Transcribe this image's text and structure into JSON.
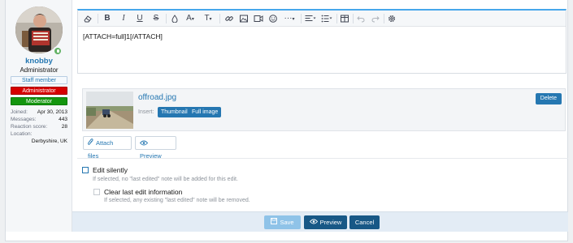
{
  "user": {
    "username": "knobby",
    "title": "Administrator",
    "banners": {
      "staff": "Staff member",
      "admin": "Administrator",
      "moderator": "Moderator"
    },
    "stats": [
      {
        "label": "Joined:",
        "value": "Apr 30, 2013"
      },
      {
        "label": "Messages:",
        "value": "443"
      },
      {
        "label": "Reaction score:",
        "value": "28"
      },
      {
        "label": "Location:",
        "value": ""
      }
    ],
    "location": "Derbyshire, UK"
  },
  "toolbar": {
    "icons": [
      "eraser-icon",
      "bold-icon",
      "italic-icon",
      "underline-icon",
      "strikethrough-icon",
      "text-color-icon",
      "font-family-icon",
      "font-size-icon",
      "link-icon",
      "image-icon",
      "media-icon",
      "smilies-icon",
      "more-options-icon",
      "align-icon",
      "list-icon",
      "table-icon",
      "undo-icon",
      "redo-icon",
      "settings-icon"
    ],
    "bold": "B",
    "italic": "I",
    "underline": "U",
    "strikethrough": "S",
    "font_family": "A",
    "font_size": "T",
    "more": "···"
  },
  "editor": {
    "content": "[ATTACH=full]1[/ATTACH]"
  },
  "attachment": {
    "file_name": "offroad.jpg",
    "insert_label": "Insert:",
    "thumbnail_label": "Thumbnail",
    "full_label": "Full image",
    "delete_label": "Delete"
  },
  "buttons": {
    "attach_files": "Attach files",
    "preview_small": "Preview",
    "save": "Save",
    "preview": "Preview",
    "cancel": "Cancel"
  },
  "options": {
    "edit_silently": "Edit silently",
    "edit_silently_hint": "If selected, no \"last edited\" note will be added for this edit.",
    "clear_last_edit": "Clear last edit information",
    "clear_last_edit_hint": "If selected, any existing \"last edited\" note will be removed."
  },
  "colors": {
    "accent": "#2577b1",
    "editor_border_top": "#47a7eb",
    "admin_banner": "#d60000",
    "moderator_banner": "#14960f",
    "footer_bg": "#e3ecf5",
    "primary_button": "#185886",
    "disabled_button": "#8fc3e8"
  }
}
